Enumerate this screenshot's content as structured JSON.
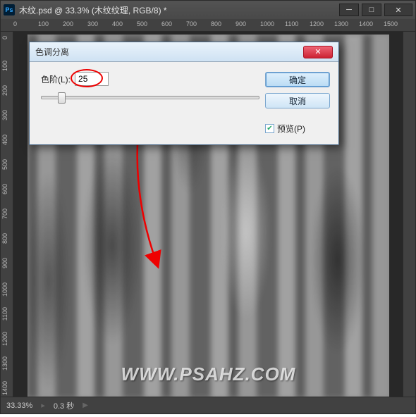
{
  "titlebar": {
    "app_icon_text": "Ps",
    "title": "木纹.psd @ 33.3% (木纹纹理, RGB/8) *"
  },
  "ruler_h": [
    "0",
    "100",
    "200",
    "300",
    "400",
    "500",
    "600",
    "700",
    "800",
    "900",
    "1000",
    "1100",
    "1200",
    "1300",
    "1400",
    "1500"
  ],
  "ruler_v": [
    "0",
    "100",
    "200",
    "300",
    "400",
    "500",
    "600",
    "700",
    "800",
    "900",
    "1000",
    "1100",
    "1200",
    "1300",
    "1400"
  ],
  "watermark": "WWW.PSAHZ.COM",
  "statusbar": {
    "zoom": "33.33%",
    "time": "0.3 秒"
  },
  "dialog": {
    "title": "色调分离",
    "levels_label": "色阶(L):",
    "levels_value": "25",
    "slider_pos_percent": 8,
    "ok": "确定",
    "cancel": "取消",
    "preview_label": "预览(P)",
    "preview_checked": true
  }
}
